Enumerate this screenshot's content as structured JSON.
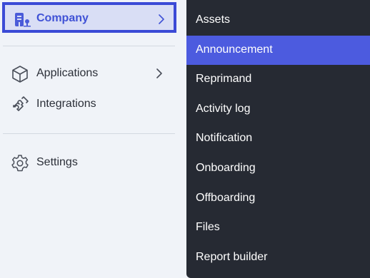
{
  "sidebar": {
    "company": {
      "label": "Company",
      "icon": "company-building-icon"
    },
    "items": [
      {
        "label": "Applications",
        "icon": "cube-icon",
        "has_submenu": true
      },
      {
        "label": "Integrations",
        "icon": "puzzle-icon",
        "has_submenu": false
      },
      {
        "label": "Settings",
        "icon": "gear-icon",
        "has_submenu": false
      }
    ]
  },
  "dropdown": {
    "items": [
      {
        "label": "Assets",
        "active": false
      },
      {
        "label": "Announcement",
        "active": true
      },
      {
        "label": "Reprimand",
        "active": false
      },
      {
        "label": "Activity log",
        "active": false
      },
      {
        "label": "Notification",
        "active": false
      },
      {
        "label": "Onboarding",
        "active": false
      },
      {
        "label": "Offboarding",
        "active": false
      },
      {
        "label": "Files",
        "active": false
      },
      {
        "label": "Report builder",
        "active": false
      }
    ]
  },
  "colors": {
    "accent": "#4052d6",
    "active_bg": "#4c5bdf",
    "dropdown_bg": "#262a33",
    "sidebar_bg": "#f0f3f8"
  }
}
